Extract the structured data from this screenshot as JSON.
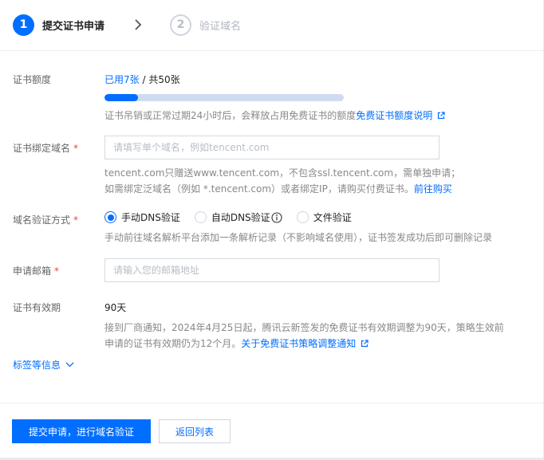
{
  "steps": [
    {
      "number": "1",
      "label": "提交证书申请",
      "state": "active"
    },
    {
      "number": "2",
      "label": "验证域名",
      "state": "inactive"
    }
  ],
  "quota": {
    "label": "证书额度",
    "used_text": "已用7张",
    "total_text": " / 共50张",
    "used": 7,
    "total": 50,
    "progress_fraction": 0.14,
    "hint_text": "证书吊销或正常过期24小时后，会释放占用免费证书的额度",
    "hint_link": "免费证书额度说明"
  },
  "domain": {
    "label": "证书绑定域名",
    "required_mark": "*",
    "placeholder": "请填写单个域名，例如tencent.com",
    "hint_line1": "tencent.com只赠送www.tencent.com，不包含ssl.tencent.com，需单独申请；",
    "hint_line2": "如需绑定泛域名（例如 *.tencent.com）或者绑定IP，请购买付费证书。",
    "hint_link": "前往购买"
  },
  "verify": {
    "label": "域名验证方式",
    "required_mark": "*",
    "options": [
      {
        "label": "手动DNS验证",
        "checked": true
      },
      {
        "label": "自动DNS验证",
        "checked": false
      },
      {
        "label": "文件验证",
        "checked": false
      }
    ],
    "hint": "手动前往域名解析平台添加一条解析记录（不影响域名使用），证书签发成功后即可删除记录"
  },
  "email": {
    "label": "申请邮箱",
    "required_mark": "*",
    "placeholder": "请输入您的邮箱地址"
  },
  "validity": {
    "label": "证书有效期",
    "value": "90天",
    "hint_line1": "接到厂商通知，2024年4月25日起，腾讯云新签发的免费证书有效期调整为90天，策略生效前",
    "hint_line2": "申请的证书有效期仍为12个月。",
    "hint_link": "关于免费证书策略调整通知"
  },
  "tags_toggle": "标签等信息",
  "buttons": {
    "submit": "提交申请，进行域名验证",
    "back": "返回列表"
  },
  "colors": {
    "accent": "#006eff",
    "required": "#e54545",
    "progress_track": "#cfdcf0"
  }
}
